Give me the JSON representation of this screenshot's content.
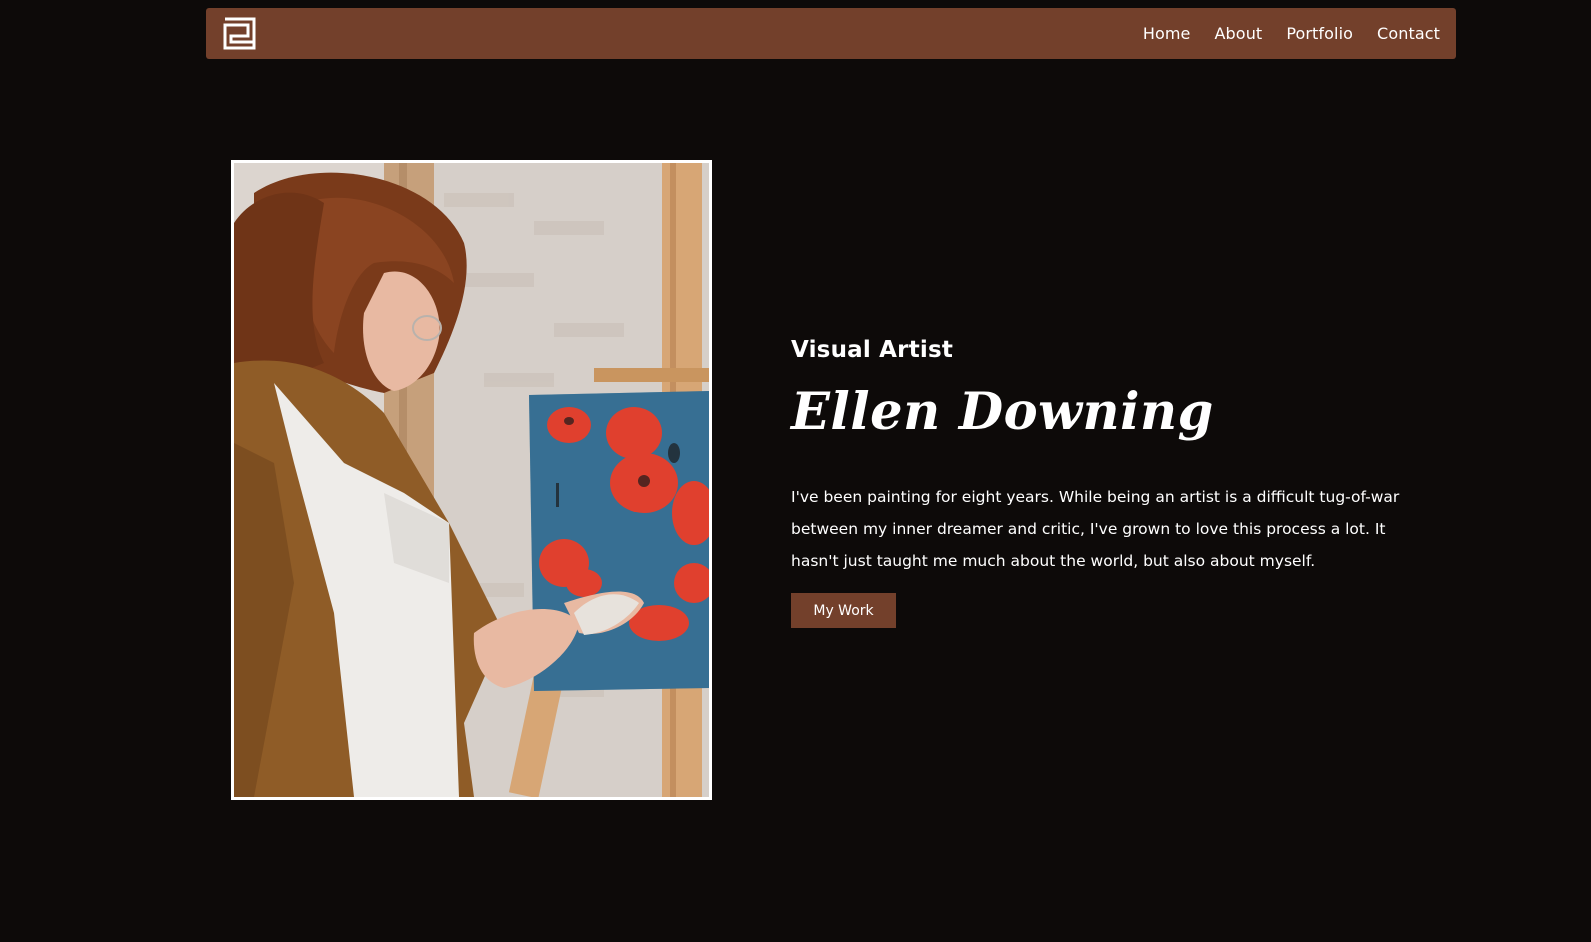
{
  "colors": {
    "background": "#0d0a09",
    "accent": "#73402b",
    "text": "#ffffff"
  },
  "header": {
    "logo_icon": "square-spiral-logo-icon",
    "nav": [
      "Home",
      "About",
      "Portfolio",
      "Contact"
    ]
  },
  "hero": {
    "image_icon": "artist-portrait-image",
    "eyebrow": "Visual Artist",
    "name": "Ellen Downing",
    "bio": "I've been painting for eight years. While being an artist is a difficult tug-of-war between my inner dreamer and critic, I've grown to love this process a lot. It hasn't just taught me much about the world, but also about myself.",
    "cta_label": "My Work"
  }
}
